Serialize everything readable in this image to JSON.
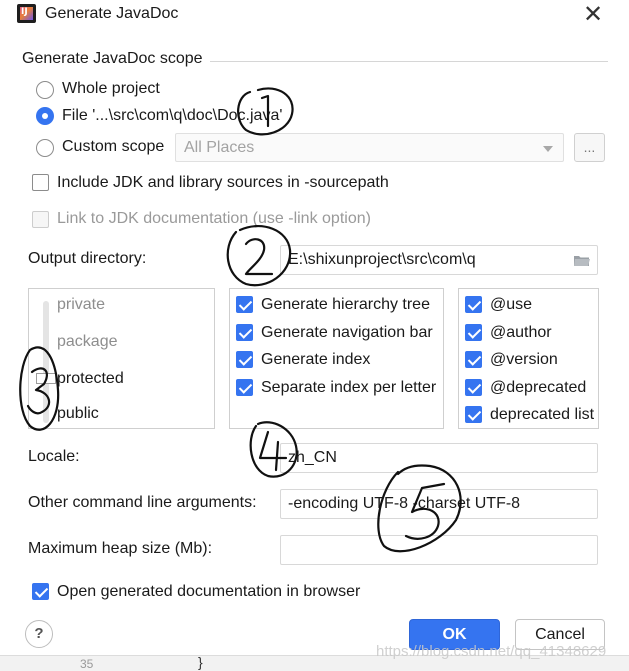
{
  "window": {
    "title": "Generate JavaDoc",
    "close_symbol": "✕"
  },
  "scope": {
    "title": "Generate JavaDoc scope",
    "options": [
      {
        "label": "Whole project",
        "checked": false
      },
      {
        "label": "File '...\\src\\com\\q\\doc\\Doc.java'",
        "checked": true
      },
      {
        "label": "Custom scope",
        "checked": false
      }
    ],
    "custom_scope_value": "All Places",
    "browse_label": "..."
  },
  "options": {
    "include_jdk": {
      "label": "Include JDK and library sources in -sourcepath",
      "checked": false
    },
    "link_jdk": {
      "label": "Link to JDK documentation (use -link option)",
      "checked": false,
      "disabled": true
    }
  },
  "output": {
    "label": "Output directory:",
    "value": "E:\\shixunproject\\src\\com\\q"
  },
  "visibility": {
    "levels": [
      "private",
      "package",
      "protected",
      "public"
    ],
    "selected": "protected"
  },
  "generate": [
    {
      "label": "Generate hierarchy tree",
      "checked": true
    },
    {
      "label": "Generate navigation bar",
      "checked": true
    },
    {
      "label": "Generate index",
      "checked": true
    },
    {
      "label": "Separate index per letter",
      "checked": true
    }
  ],
  "tags": [
    {
      "label": "@use",
      "checked": true
    },
    {
      "label": "@author",
      "checked": true
    },
    {
      "label": "@version",
      "checked": true
    },
    {
      "label": "@deprecated",
      "checked": true
    },
    {
      "label": "deprecated list",
      "checked": true
    }
  ],
  "locale": {
    "label": "Locale:",
    "value": "zh_CN"
  },
  "other_args": {
    "label": "Other command line arguments:",
    "value": "-encoding UTF-8 -charset UTF-8"
  },
  "heap": {
    "label": "Maximum heap size (Mb):",
    "value": ""
  },
  "open_browser": {
    "label": "Open generated documentation in browser",
    "checked": true
  },
  "footer": {
    "help_label": "?",
    "ok_label": "OK",
    "cancel_label": "Cancel"
  },
  "background_editor": {
    "line_number": "35",
    "brace": "}"
  },
  "watermark": "https://blog.csdn.net/qq_41348629",
  "colors": {
    "accent": "#3574f0",
    "annotation_ink": "#111111"
  }
}
